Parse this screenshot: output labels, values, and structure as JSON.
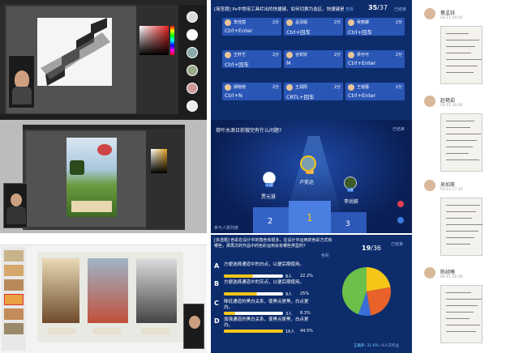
{
  "answer_board": {
    "header": "[简答题] Ps中常用工具栏出的快捷键，如何切换为选区。快捷键是 ( )",
    "link": "查看",
    "status": "已结束",
    "count_a": "35",
    "count_b": "37",
    "cards": [
      {
        "name": "李佳茵",
        "points": "2分",
        "answer": "Ctrl+Enter"
      },
      {
        "name": "孟清娟",
        "points": "2分",
        "answer": "Ctrl+回车"
      },
      {
        "name": "吴丽娜",
        "points": "2分",
        "answer": "Ctrl+回车"
      },
      {
        "name": "王轩艺",
        "points": "2分",
        "answer": "Ctrl+回车"
      },
      {
        "name": "谷钦姣",
        "points": "2分",
        "answer": "M"
      },
      {
        "name": "侯可可",
        "points": "2分",
        "answer": "Ctrl+Enter"
      },
      {
        "name": "郝晓南",
        "points": "2分",
        "answer": "Ctrl+N"
      },
      {
        "name": "王润阳",
        "points": "2分",
        "answer": "CRTL+回车"
      },
      {
        "name": "王瑶蕾",
        "points": "2分",
        "answer": "Ctrl+Enter"
      }
    ]
  },
  "podium": {
    "question": "荷叶水滴日前做完有什么问题?",
    "status": "已结束",
    "winner_first": {
      "name": "卢奕达",
      "points": "+10"
    },
    "winner_second": {
      "name": "贾元慧",
      "points": "+10"
    },
    "winner_third": {
      "name": "李尚蔚",
      "points": "+8"
    },
    "place_1": "1",
    "place_2": "2",
    "place_3": "3",
    "footer": "参与人数列表"
  },
  "poll": {
    "question": "[多选题] 色彩在设计中的角色有很多，在设计中运用的色彩方式有哪些，那再次的作品中的色彩运用会有哪些类型的?",
    "status": "已结束",
    "count_a": "19",
    "count_b": "36",
    "mode": "色彩",
    "options": [
      {
        "letter": "A",
        "text": "方便选择通道中的白点，以便后期使用。",
        "count": "8人",
        "pct": "22.2%",
        "ratio": 0.222
      },
      {
        "letter": "B",
        "text": "方便选择通道中的灰点，以便后期使用。",
        "count": "9人",
        "pct": "25%",
        "ratio": 0.25
      },
      {
        "letter": "C",
        "text": "降低通道的黑白关系，使黑点更黑，白点更白。",
        "count": "3人",
        "pct": "8.3%",
        "ratio": 0.083
      },
      {
        "letter": "D",
        "text": "加强通道的黑白关系，使黑点更黑，白点更白。",
        "count": "16人",
        "pct": "44.5%",
        "ratio": 0.445
      }
    ],
    "correct": "正确率: 31.6%",
    "participants": "6人交作业",
    "pie_colors": [
      "#f5c518",
      "#e8622a",
      "#3b6fd8",
      "#6cc04a"
    ]
  },
  "submissions": [
    {
      "name": "蔡孟钰",
      "date": "03-11 20:54"
    },
    {
      "name": "赵艳茹",
      "date": "03-11 16:40"
    },
    {
      "name": "吴如美",
      "date": "03-11 17:33"
    },
    {
      "name": "陈经曦",
      "date": "03-11 16:39"
    }
  ],
  "colors": {
    "navy": "#0d2c6c",
    "card": "#2a56b6",
    "accent": "#f5c518"
  }
}
